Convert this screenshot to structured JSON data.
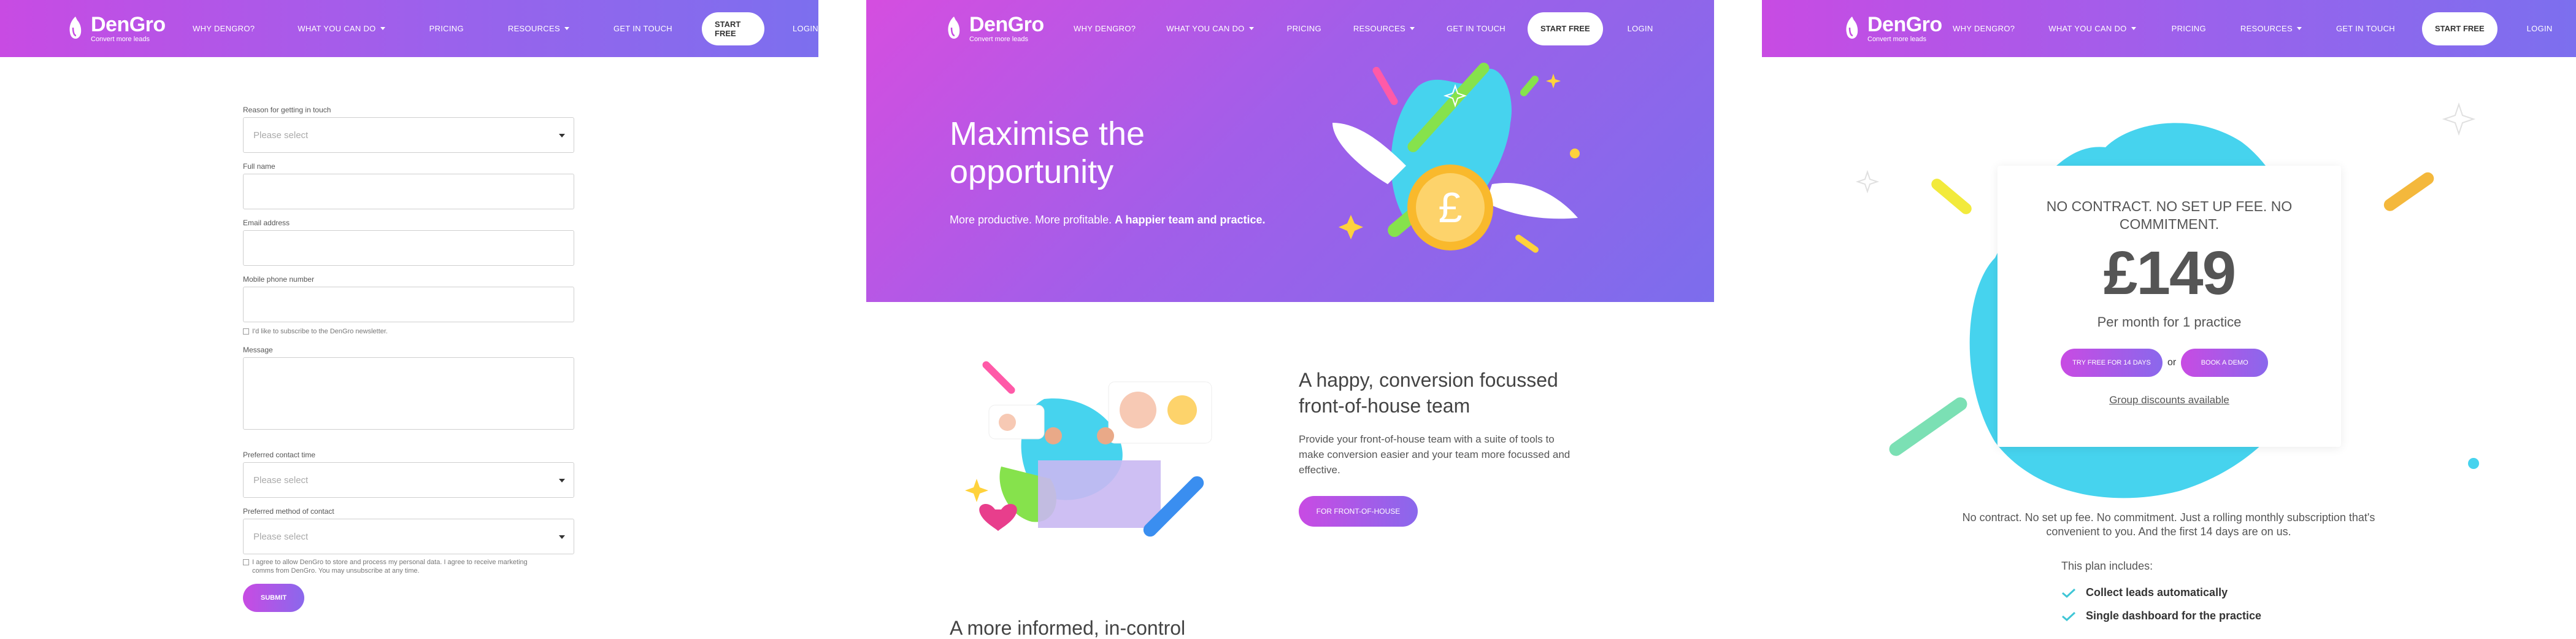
{
  "nav": {
    "brand": "DenGro",
    "tagline": "Convert more leads",
    "links": [
      "WHY DENGRO?",
      "WHAT YOU CAN DO",
      "PRICING",
      "RESOURCES",
      "GET IN TOUCH"
    ],
    "start_free": "START FREE",
    "login": "LOGIN"
  },
  "form": {
    "reason_label": "Reason for getting in touch",
    "reason_placeholder": "Please select",
    "fullname_label": "Full name",
    "email_label": "Email address",
    "mobile_label": "Mobile phone number",
    "newsletter_text": "I'd like to subscribe to the DenGro newsletter.",
    "message_label": "Message",
    "contact_time_label": "Preferred contact time",
    "contact_time_placeholder": "Please select",
    "contact_method_label": "Preferred method of contact",
    "contact_method_placeholder": "Please select",
    "consent_text": "I agree to allow DenGro to store and process my personal data. I agree to receive marketing comms from DenGro. You may unsubscribe at any time.",
    "submit": "SUBMIT"
  },
  "hero": {
    "title": "Maximise the opportunity",
    "subtitle_plain": "More productive. More profitable.",
    "subtitle_bold": "A happier team and practice."
  },
  "section": {
    "title": "A happy, conversion focussed front-of-house team",
    "body": "Provide your front-of-house team with a suite of tools to make conversion easier and your team more focussed and effective.",
    "button": "FOR FRONT-OF-HOUSE",
    "next_title": "A more informed, in-control"
  },
  "pricing": {
    "headline": "NO CONTRACT. NO SET UP FEE. NO COMMITMENT.",
    "price": "£149",
    "per": "Per month for 1 practice",
    "trial_button": "TRY FREE FOR 14 DAYS",
    "or": "or",
    "demo_button": "BOOK A DEMO",
    "group_link": "Group discounts available",
    "description": "No contract. No set up fee. No commitment. Just a rolling monthly subscription that's convenient to you. And the first 14 days are on us.",
    "plan_title": "This plan includes:",
    "plan_items": [
      "Collect leads automatically",
      "Single dashboard for the practice"
    ]
  },
  "colors": {
    "accent_pink": "#c84be3",
    "accent_purple": "#8a68ec",
    "check_teal": "#3fc6d6"
  }
}
